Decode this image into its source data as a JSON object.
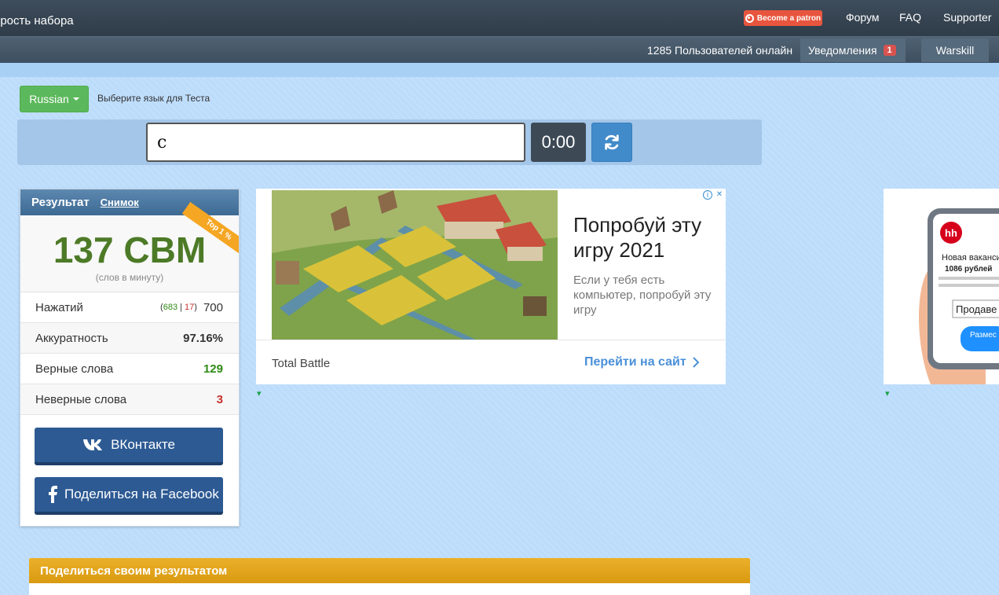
{
  "nav": {
    "brand": "орость набора",
    "patron_label": "Become a patron",
    "forum": "Форум",
    "faq": "FAQ",
    "supporter": "Supporter"
  },
  "subnav": {
    "online": "1285 Пользователей онлайн",
    "notifications": "Уведомления",
    "notifications_count": "1",
    "user": "Warskill"
  },
  "language": {
    "selected": "Russian",
    "hint": "Выберите язык для Теста"
  },
  "typing": {
    "input_value": "с",
    "timer": "0:00"
  },
  "result": {
    "title": "Результат",
    "snapshot": "Снимок",
    "ribbon": "Top 1 %",
    "wpm": "137 СВМ",
    "wpm_sub": "(слов в минуту)",
    "rows": [
      {
        "label": "Нажатий",
        "correct": "683",
        "wrong": "17",
        "value": "700"
      },
      {
        "label": "Аккуратность",
        "value": "97.16%"
      },
      {
        "label": "Верные слова",
        "value": "129"
      },
      {
        "label": "Неверные слова",
        "value": "3"
      }
    ],
    "vk_label": "ВКонтакте",
    "fb_label": "Поделиться на Facebook"
  },
  "ad": {
    "title": "Попробуй эту игру 2021",
    "desc": "Если у тебя есть компьютер, попробуй эту игру",
    "brand": "Total Battle",
    "cta": "Перейти на сайт"
  },
  "ad2": {
    "logo": "hh",
    "line1": "Новая вакансия",
    "line2": "1086 рублей",
    "field": "Продаве",
    "button": "Размес ваканс"
  },
  "share": {
    "title": "Поделиться своим результатом"
  },
  "colors": {
    "accent_green": "#4d7a27",
    "nav_bg": "#34414e",
    "share_header": "#e0a21a"
  }
}
